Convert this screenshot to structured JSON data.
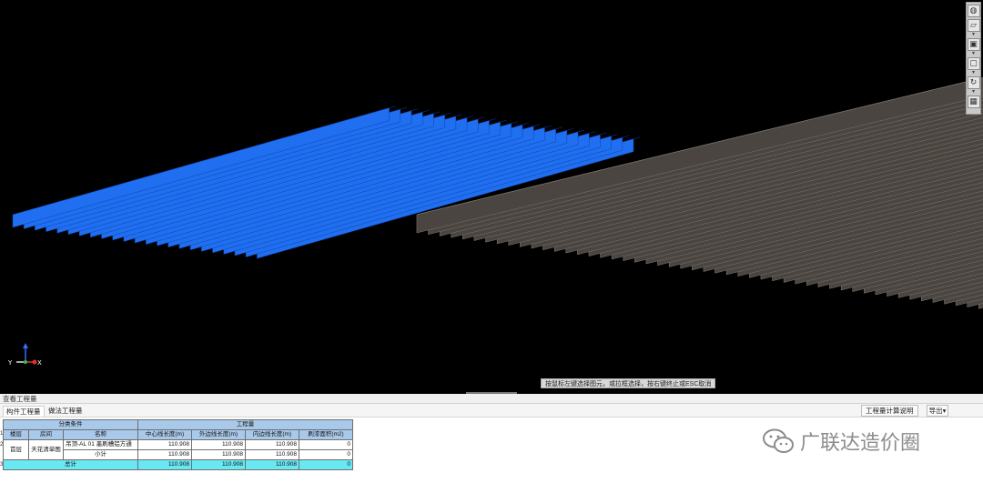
{
  "viewport": {
    "hint": "按鼠标左键选择图元，或拉框选择，按右键终止或ESC取消",
    "axis_labels": {
      "y": "Y",
      "x": "X"
    },
    "toolbar_icons": [
      "orbit-icon",
      "layer-icon",
      "view-box-icon",
      "frame-icon",
      "rotate-icon",
      "grid-icon"
    ],
    "colors": {
      "selected": "#1f6ff0",
      "unselected": "#4a4540",
      "background": "#000000"
    }
  },
  "panel": {
    "title": "查看工程量",
    "tabs": [
      "构件工程量",
      "做法工程量"
    ],
    "calc_help": "工程量计算说明",
    "export": "导出"
  },
  "table": {
    "group_headers": {
      "category": "分类条件",
      "quantity": "工程量"
    },
    "columns": [
      "楼层",
      "房间",
      "名称",
      "中心线长度(m)",
      "外边线长度(m)",
      "内边线长度(m)",
      "刷漆面积(m2)"
    ],
    "row_numbers": [
      "1",
      "2",
      "3"
    ],
    "rows": [
      {
        "floor": "首层",
        "room": "天花清单图",
        "name": "吊顶-AL 01 墨刷槽铝方通",
        "center": "110.908",
        "outer": "110.908",
        "inner": "110.908",
        "paint": "0"
      },
      {
        "floor": "",
        "room": "",
        "name": "小计",
        "center": "110.908",
        "outer": "110.908",
        "inner": "110.908",
        "paint": "0"
      }
    ],
    "total": {
      "label": "总计",
      "center": "110.908",
      "outer": "110.908",
      "inner": "110.908",
      "paint": "0"
    }
  },
  "watermark": "广联达造价圈"
}
